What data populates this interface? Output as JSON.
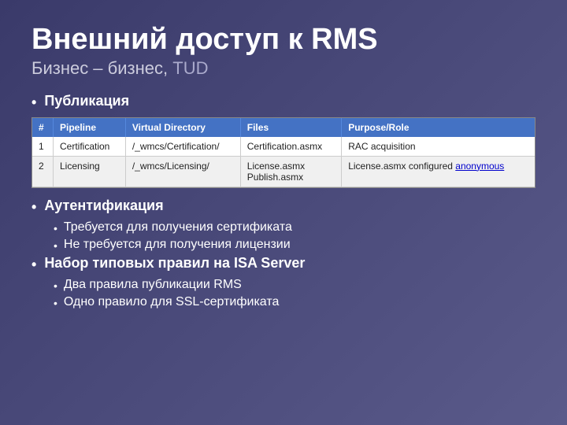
{
  "header": {
    "main_title": "Внешний доступ к RMS",
    "subtitle_part1": "Бизнес – бизнес, ",
    "subtitle_tud": "TUD"
  },
  "table": {
    "columns": [
      "#",
      "Pipeline",
      "Virtual Directory",
      "Files",
      "Purpose/Role"
    ],
    "rows": [
      {
        "num": "1",
        "pipeline": "Certification",
        "virtual_dir": "/_wmcs/Certification/",
        "files": "Certification.asmx",
        "purpose": "RAC acquisition"
      },
      {
        "num": "2",
        "pipeline": "Licensing",
        "virtual_dir": "/_wmcs/Licensing/",
        "files": "License.asmx\nPublish.asmx",
        "purpose_text": "License.asmx configured ",
        "purpose_link": "anonymous"
      }
    ]
  },
  "sections": {
    "publication_label": "Публикация",
    "authentication_label": "Аутентификация",
    "auth_sub1": "Требуется для получения сертификата",
    "auth_sub2": "Не требуется для получения лицензии",
    "rules_label": "Набор типовых правил на",
    "rules_label_server": " ISA Server",
    "rules_sub1": "Два правила публикации RMS",
    "rules_sub2": "Одно правило для SSL-сертификата"
  },
  "bullet_char": "•"
}
